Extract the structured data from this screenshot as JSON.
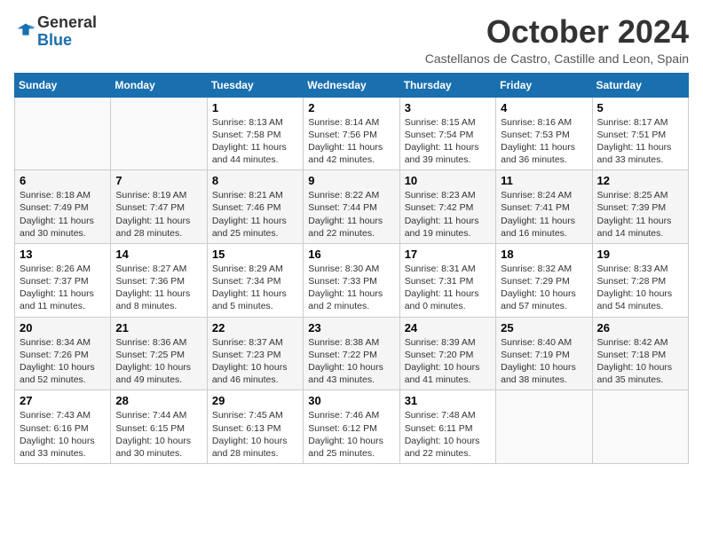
{
  "logo": {
    "general": "General",
    "blue": "Blue"
  },
  "title": "October 2024",
  "location": "Castellanos de Castro, Castille and Leon, Spain",
  "days_of_week": [
    "Sunday",
    "Monday",
    "Tuesday",
    "Wednesday",
    "Thursday",
    "Friday",
    "Saturday"
  ],
  "weeks": [
    [
      {
        "day": "",
        "content": ""
      },
      {
        "day": "",
        "content": ""
      },
      {
        "day": "1",
        "content": "Sunrise: 8:13 AM\nSunset: 7:58 PM\nDaylight: 11 hours and 44 minutes."
      },
      {
        "day": "2",
        "content": "Sunrise: 8:14 AM\nSunset: 7:56 PM\nDaylight: 11 hours and 42 minutes."
      },
      {
        "day": "3",
        "content": "Sunrise: 8:15 AM\nSunset: 7:54 PM\nDaylight: 11 hours and 39 minutes."
      },
      {
        "day": "4",
        "content": "Sunrise: 8:16 AM\nSunset: 7:53 PM\nDaylight: 11 hours and 36 minutes."
      },
      {
        "day": "5",
        "content": "Sunrise: 8:17 AM\nSunset: 7:51 PM\nDaylight: 11 hours and 33 minutes."
      }
    ],
    [
      {
        "day": "6",
        "content": "Sunrise: 8:18 AM\nSunset: 7:49 PM\nDaylight: 11 hours and 30 minutes."
      },
      {
        "day": "7",
        "content": "Sunrise: 8:19 AM\nSunset: 7:47 PM\nDaylight: 11 hours and 28 minutes."
      },
      {
        "day": "8",
        "content": "Sunrise: 8:21 AM\nSunset: 7:46 PM\nDaylight: 11 hours and 25 minutes."
      },
      {
        "day": "9",
        "content": "Sunrise: 8:22 AM\nSunset: 7:44 PM\nDaylight: 11 hours and 22 minutes."
      },
      {
        "day": "10",
        "content": "Sunrise: 8:23 AM\nSunset: 7:42 PM\nDaylight: 11 hours and 19 minutes."
      },
      {
        "day": "11",
        "content": "Sunrise: 8:24 AM\nSunset: 7:41 PM\nDaylight: 11 hours and 16 minutes."
      },
      {
        "day": "12",
        "content": "Sunrise: 8:25 AM\nSunset: 7:39 PM\nDaylight: 11 hours and 14 minutes."
      }
    ],
    [
      {
        "day": "13",
        "content": "Sunrise: 8:26 AM\nSunset: 7:37 PM\nDaylight: 11 hours and 11 minutes."
      },
      {
        "day": "14",
        "content": "Sunrise: 8:27 AM\nSunset: 7:36 PM\nDaylight: 11 hours and 8 minutes."
      },
      {
        "day": "15",
        "content": "Sunrise: 8:29 AM\nSunset: 7:34 PM\nDaylight: 11 hours and 5 minutes."
      },
      {
        "day": "16",
        "content": "Sunrise: 8:30 AM\nSunset: 7:33 PM\nDaylight: 11 hours and 2 minutes."
      },
      {
        "day": "17",
        "content": "Sunrise: 8:31 AM\nSunset: 7:31 PM\nDaylight: 11 hours and 0 minutes."
      },
      {
        "day": "18",
        "content": "Sunrise: 8:32 AM\nSunset: 7:29 PM\nDaylight: 10 hours and 57 minutes."
      },
      {
        "day": "19",
        "content": "Sunrise: 8:33 AM\nSunset: 7:28 PM\nDaylight: 10 hours and 54 minutes."
      }
    ],
    [
      {
        "day": "20",
        "content": "Sunrise: 8:34 AM\nSunset: 7:26 PM\nDaylight: 10 hours and 52 minutes."
      },
      {
        "day": "21",
        "content": "Sunrise: 8:36 AM\nSunset: 7:25 PM\nDaylight: 10 hours and 49 minutes."
      },
      {
        "day": "22",
        "content": "Sunrise: 8:37 AM\nSunset: 7:23 PM\nDaylight: 10 hours and 46 minutes."
      },
      {
        "day": "23",
        "content": "Sunrise: 8:38 AM\nSunset: 7:22 PM\nDaylight: 10 hours and 43 minutes."
      },
      {
        "day": "24",
        "content": "Sunrise: 8:39 AM\nSunset: 7:20 PM\nDaylight: 10 hours and 41 minutes."
      },
      {
        "day": "25",
        "content": "Sunrise: 8:40 AM\nSunset: 7:19 PM\nDaylight: 10 hours and 38 minutes."
      },
      {
        "day": "26",
        "content": "Sunrise: 8:42 AM\nSunset: 7:18 PM\nDaylight: 10 hours and 35 minutes."
      }
    ],
    [
      {
        "day": "27",
        "content": "Sunrise: 7:43 AM\nSunset: 6:16 PM\nDaylight: 10 hours and 33 minutes."
      },
      {
        "day": "28",
        "content": "Sunrise: 7:44 AM\nSunset: 6:15 PM\nDaylight: 10 hours and 30 minutes."
      },
      {
        "day": "29",
        "content": "Sunrise: 7:45 AM\nSunset: 6:13 PM\nDaylight: 10 hours and 28 minutes."
      },
      {
        "day": "30",
        "content": "Sunrise: 7:46 AM\nSunset: 6:12 PM\nDaylight: 10 hours and 25 minutes."
      },
      {
        "day": "31",
        "content": "Sunrise: 7:48 AM\nSunset: 6:11 PM\nDaylight: 10 hours and 22 minutes."
      },
      {
        "day": "",
        "content": ""
      },
      {
        "day": "",
        "content": ""
      }
    ]
  ]
}
